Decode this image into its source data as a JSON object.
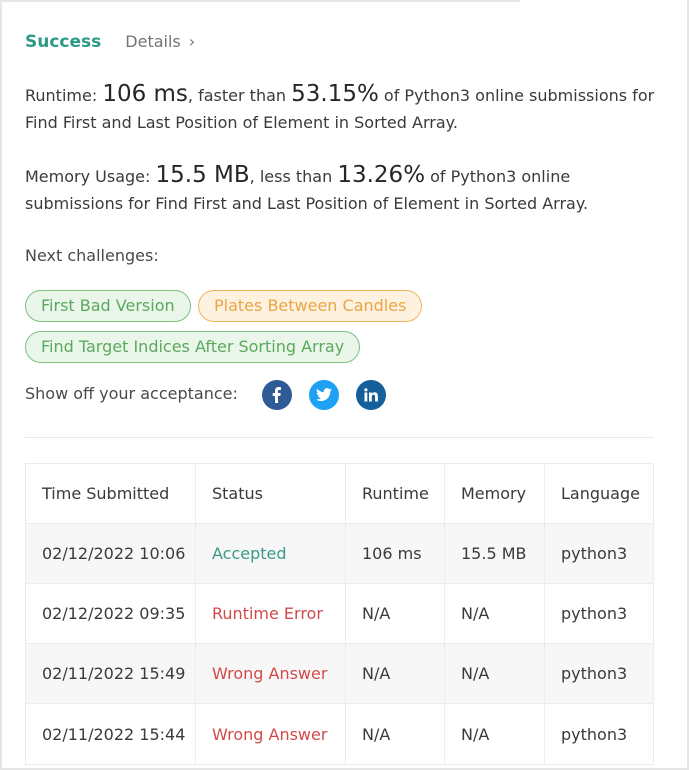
{
  "header": {
    "status": "Success",
    "details_label": "Details",
    "details_icon": "chevron-right-icon"
  },
  "runtime": {
    "label": "Runtime:",
    "value": "106 ms",
    "comparison": "faster than",
    "percent": "53.15%",
    "suffix": "of Python3 online submissions for Find First and Last Position of Element in Sorted Array."
  },
  "memory": {
    "label": "Memory Usage:",
    "value": "15.5 MB",
    "comparison": "less than",
    "percent": "13.26%",
    "suffix": "of Python3 online submissions for Find First and Last Position of Element in Sorted Array."
  },
  "next_challenges": {
    "label": "Next challenges:",
    "items": [
      {
        "label": "First Bad Version",
        "difficulty_color": "#5ba95e"
      },
      {
        "label": "Plates Between Candles",
        "difficulty_color": "#eba544"
      },
      {
        "label": "Find Target Indices After Sorting Array",
        "difficulty_color": "#5ba95e"
      }
    ]
  },
  "share": {
    "label": "Show off your acceptance:",
    "icons": [
      "facebook-icon",
      "twitter-icon",
      "linkedin-icon"
    ]
  },
  "submissions": {
    "headers": [
      "Time Submitted",
      "Status",
      "Runtime",
      "Memory",
      "Language"
    ],
    "rows": [
      {
        "time": "02/12/2022 10:06",
        "status": "Accepted",
        "runtime": "106 ms",
        "memory": "15.5 MB",
        "language": "python3"
      },
      {
        "time": "02/12/2022 09:35",
        "status": "Runtime Error",
        "runtime": "N/A",
        "memory": "N/A",
        "language": "python3"
      },
      {
        "time": "02/11/2022 15:49",
        "status": "Wrong Answer",
        "runtime": "N/A",
        "memory": "N/A",
        "language": "python3"
      },
      {
        "time": "02/11/2022 15:44",
        "status": "Wrong Answer",
        "runtime": "N/A",
        "memory": "N/A",
        "language": "python3"
      }
    ]
  },
  "colors": {
    "success": "#2b9a84",
    "accepted": "#3a9a87",
    "error": "#d14a4a",
    "facebook": "#2e5a96",
    "twitter": "#1ea1f2",
    "linkedin": "#155f9b"
  }
}
